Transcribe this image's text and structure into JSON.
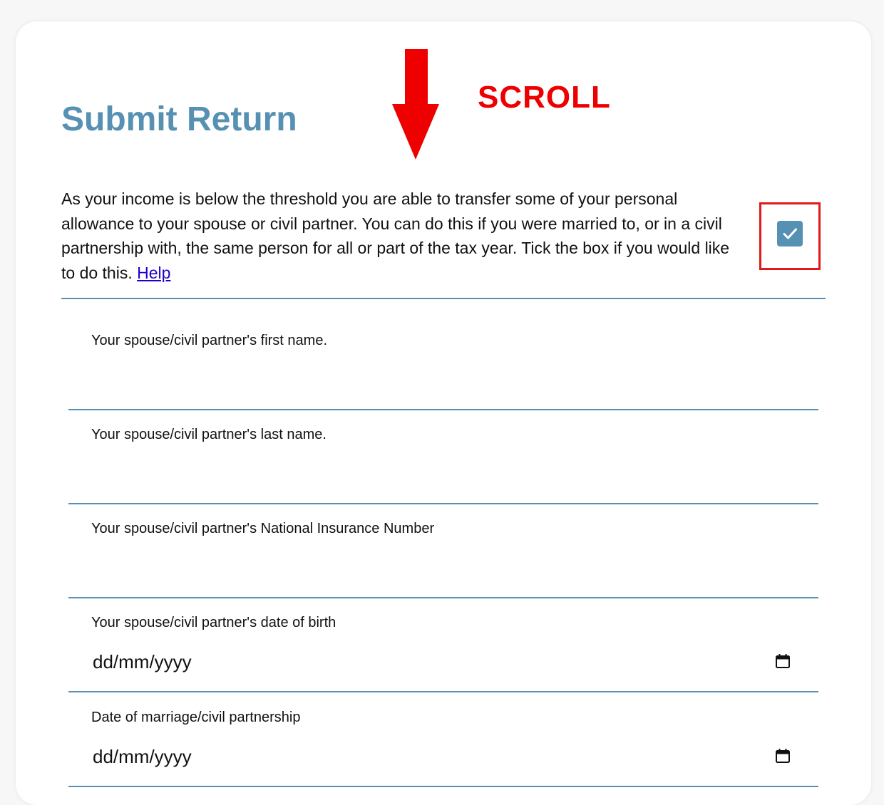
{
  "page": {
    "title": "Submit Return",
    "scroll_hint": "SCROLL",
    "accent_color": "#5690b2",
    "annotation_color": "#ee0000"
  },
  "intro": {
    "text": "As your income is below the threshold you are able to transfer some of your personal allowance to your spouse or civil partner. You can do this if you were married to, or in a civil partnership with, the same person for all or part of the tax year. Tick the box if you would like to do this. ",
    "help_link": "Help",
    "transfer_checkbox_checked": true
  },
  "fields": [
    {
      "label": "Your spouse/civil partner's first name.",
      "value": ""
    },
    {
      "label": "Your spouse/civil partner's last name.",
      "value": ""
    },
    {
      "label": "Your spouse/civil partner's National Insurance Number",
      "value": ""
    },
    {
      "label": "Your spouse/civil partner's date of birth",
      "value": "dd/mm/yyyy",
      "icon": "calendar-icon"
    },
    {
      "label": "Date of marriage/civil partnership",
      "value": "dd/mm/yyyy",
      "icon": "calendar-icon"
    }
  ]
}
